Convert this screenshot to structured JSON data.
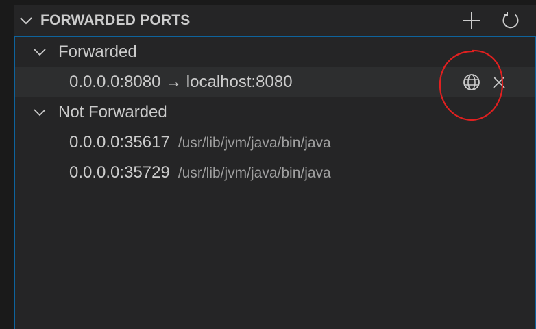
{
  "section": {
    "title": "FORWARDED PORTS",
    "actions": {
      "add_icon": "add-icon",
      "refresh_icon": "refresh-icon"
    }
  },
  "groups": [
    {
      "label": "Forwarded",
      "expanded": true,
      "items": [
        {
          "label": "0.0.0.0:8080 → localhost:8080",
          "description": "",
          "selected": true,
          "actions": [
            "globe-icon",
            "close-icon"
          ]
        }
      ]
    },
    {
      "label": "Not Forwarded",
      "expanded": true,
      "items": [
        {
          "label": "0.0.0.0:35617",
          "description": "/usr/lib/jvm/java/bin/java"
        },
        {
          "label": "0.0.0.0:35729",
          "description": "/usr/lib/jvm/java/bin/java"
        }
      ]
    }
  ],
  "colors": {
    "panel_bg": "#252526",
    "focus_border": "#0e639c",
    "text": "#cccccc",
    "description": "#a0a0a0",
    "annotation": "#e02020"
  }
}
